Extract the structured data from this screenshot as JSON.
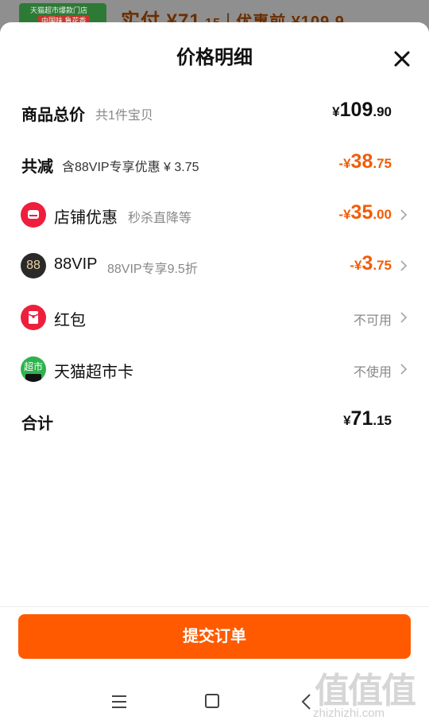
{
  "background": {
    "thumb_line1": "天猫超市爆款门店",
    "thumb_line2": "中国味 鲁花香",
    "paid_label": "实付 ¥",
    "paid_int": "71",
    "paid_dec": ".15",
    "orig_label": "优惠前 ¥109.9"
  },
  "sheet": {
    "title": "价格明细",
    "close_icon": "close-icon"
  },
  "rows": {
    "goods_total": {
      "label": "商品总价",
      "sub": "共1件宝贝",
      "currency": "¥",
      "int": "109",
      "dec": ".90"
    },
    "total_reduce": {
      "label": "共减",
      "sub": "含88VIP专享优惠 ¥ 3.75",
      "currency": "-¥",
      "int": "38",
      "dec": ".75"
    },
    "shop_discount": {
      "label": "店铺优惠",
      "sub": "秒杀直降等",
      "currency": "-¥",
      "int": "35",
      "dec": ".00"
    },
    "vip88": {
      "icon_text": "88",
      "label": "88VIP",
      "sub": "88VIP专享9.5折",
      "currency": "-¥",
      "int": "3",
      "dec": ".75"
    },
    "red_packet": {
      "label": "红包",
      "status": "不可用"
    },
    "tmall_card": {
      "icon_text": "超市",
      "label": "天猫超市卡",
      "status": "不使用"
    },
    "sum": {
      "label": "合计",
      "currency": "¥",
      "int": "71",
      "dec": ".15"
    }
  },
  "submit_label": "提交订单",
  "watermark": {
    "big": "值值值",
    "small": "zhizhizhi.com"
  },
  "colors": {
    "accent": "#ff5a00",
    "discount": "#f25c05",
    "shop_icon": "#ee1f3c",
    "vip_icon": "#2b2a28",
    "tmall_card_icon": "#2fb24c"
  }
}
